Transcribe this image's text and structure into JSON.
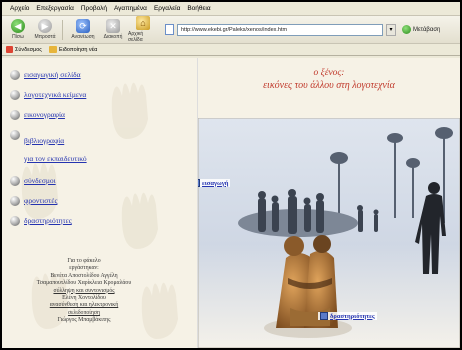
{
  "menu": [
    "Αρχείο",
    "Επεξεργασία",
    "Προβολή",
    "Αγαπημένα",
    "Εργαλεία",
    "Βοήθεια"
  ],
  "toolbar": {
    "back": "Πίσω",
    "forward": "Μπροστά",
    "refresh": "Ανανέωση",
    "stop": "Διακοπή",
    "home": "Αρχική σελίδα"
  },
  "address": {
    "url": "http://www.ekebi.gr/Paleks/xenos/index.htm",
    "go_label": "Μετάβαση"
  },
  "links_bar": {
    "item1": "Σύνδεσμος",
    "item2": "Ειδοποίηση νέα"
  },
  "sidebar": {
    "items": [
      {
        "label": "εισαγωγική σελίδα"
      },
      {
        "label": "λογοτεχνικά κείμενα"
      },
      {
        "label": "εικονογραφία"
      },
      {
        "label": "βιβλιογραφία",
        "label2": "για τον εκπαιδευτικό"
      },
      {
        "label": "σύνδεσμοι"
      },
      {
        "label": "φροντιστές"
      },
      {
        "label": "δραστηριότητες"
      }
    ],
    "credits": {
      "line1": "Για το φάκελο",
      "line2": "εργάστηκαν:",
      "line3": "Βενέτα Αποστολίδου Αγγέλη",
      "line4": "Τσαμαπουτλίδου Χαρίκλεια Κρομαλάου",
      "line5": "σύλληψη και συντονισμός",
      "line6": "Ελένη Χοντολίδου",
      "line7": "ανασύνθεση και ηλεκτρονική",
      "line8": "σελιδοποίηση",
      "line9": "Γιώργος Μπαμβάκιτης"
    }
  },
  "main": {
    "title_line1": "ο ξένος:",
    "title_line2": "εικόνες του άλλου στη λογοτεχνία",
    "link_intro": "εισαγωγή",
    "link_activities": "δραστηριότητες"
  },
  "colors": {
    "title_red": "#c0392b",
    "link_blue": "#2433b0",
    "sidebar_bg": "#f6f2e6"
  }
}
